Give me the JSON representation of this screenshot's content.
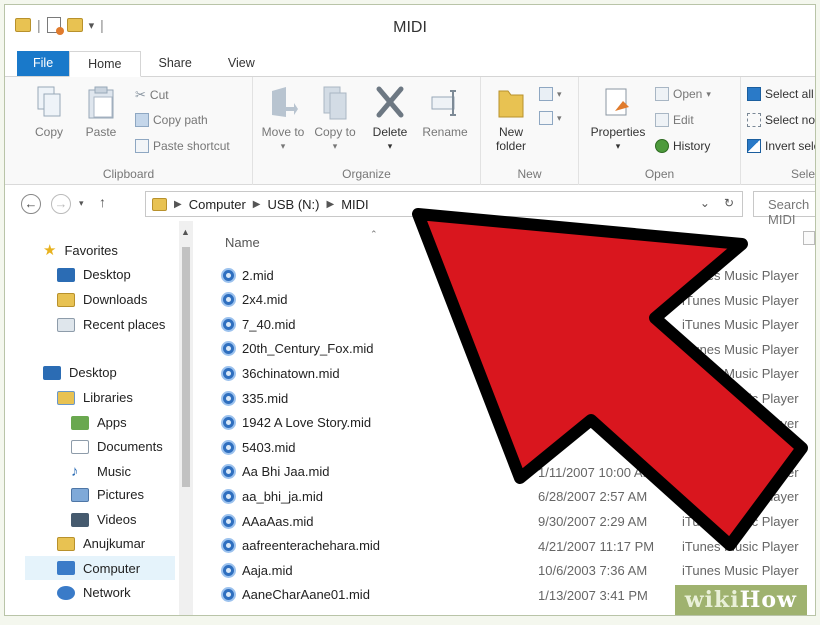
{
  "window": {
    "title": "MIDI"
  },
  "tabs": [
    "File",
    "Home",
    "Share",
    "View"
  ],
  "ribbon": {
    "clipboard": {
      "label": "Clipboard",
      "copy": "Copy",
      "paste": "Paste",
      "cut": "Cut",
      "copy_path": "Copy path",
      "paste_shortcut": "Paste shortcut"
    },
    "organize": {
      "label": "Organize",
      "move_to": "Move to",
      "copy_to": "Copy to",
      "delete": "Delete",
      "rename": "Rename"
    },
    "new": {
      "label": "New",
      "new_folder": "New folder"
    },
    "open": {
      "label": "Open",
      "properties": "Properties",
      "open": "Open",
      "edit": "Edit",
      "history": "History"
    },
    "select": {
      "label": "Select",
      "select_all": "Select all",
      "select_none": "Select none",
      "invert_selection": "Invert selection"
    }
  },
  "address": {
    "crumbs": [
      "Computer",
      "USB (N:)",
      "MIDI"
    ],
    "search_placeholder": "Search MIDI"
  },
  "navpane": {
    "favorites": "Favorites",
    "favorites_items": [
      "Desktop",
      "Downloads",
      "Recent places"
    ],
    "desktop": "Desktop",
    "libraries": "Libraries",
    "library_items": [
      "Apps",
      "Documents",
      "Music",
      "Pictures",
      "Videos"
    ],
    "user": "Anujkumar",
    "computer": "Computer",
    "network": "Network"
  },
  "filelist": {
    "column_name": "Name",
    "files": [
      {
        "name": "2.mid",
        "date": "",
        "type": "iTunes Music Player"
      },
      {
        "name": "2x4.mid",
        "date": "",
        "type": "iTunes Music Player"
      },
      {
        "name": "7_40.mid",
        "date": "",
        "type": "iTunes Music Player"
      },
      {
        "name": "20th_Century_Fox.mid",
        "date": "",
        "type": "iTunes Music Player"
      },
      {
        "name": "36chinatown.mid",
        "date": "",
        "type": "iTunes Music Player"
      },
      {
        "name": "335.mid",
        "date": "",
        "type": "iTunes Music Player"
      },
      {
        "name": "1942 A Love Story.mid",
        "date": "",
        "type": "iTunes Music Player"
      },
      {
        "name": "5403.mid",
        "date": "",
        "type": "iTunes Music Player"
      },
      {
        "name": "Aa Bhi Jaa.mid",
        "date": "1/11/2007 10:00 AM",
        "type": "iTunes Music Player"
      },
      {
        "name": "aa_bhi_ja.mid",
        "date": "6/28/2007 2:57 AM",
        "type": "iTunes Music Player"
      },
      {
        "name": "AAaAas.mid",
        "date": "9/30/2007 2:29 AM",
        "type": "iTunes Music Player"
      },
      {
        "name": "aafreenterachehara.mid",
        "date": "4/21/2007 11:17 PM",
        "type": "iTunes Music Player"
      },
      {
        "name": "Aaja.mid",
        "date": "10/6/2003 7:36 AM",
        "type": "iTunes Music Player"
      },
      {
        "name": "AaneCharAane01.mid",
        "date": "1/13/2007 3:41 PM",
        "type": "iTunes Music Player"
      }
    ]
  },
  "watermark": {
    "w1": "wiki",
    "w2": "How"
  },
  "colors": {
    "file_tab": "#1979ca",
    "arrow_fill": "#d9161e",
    "arrow_stroke": "#000000",
    "watermark_bg": "#9fb26f"
  }
}
